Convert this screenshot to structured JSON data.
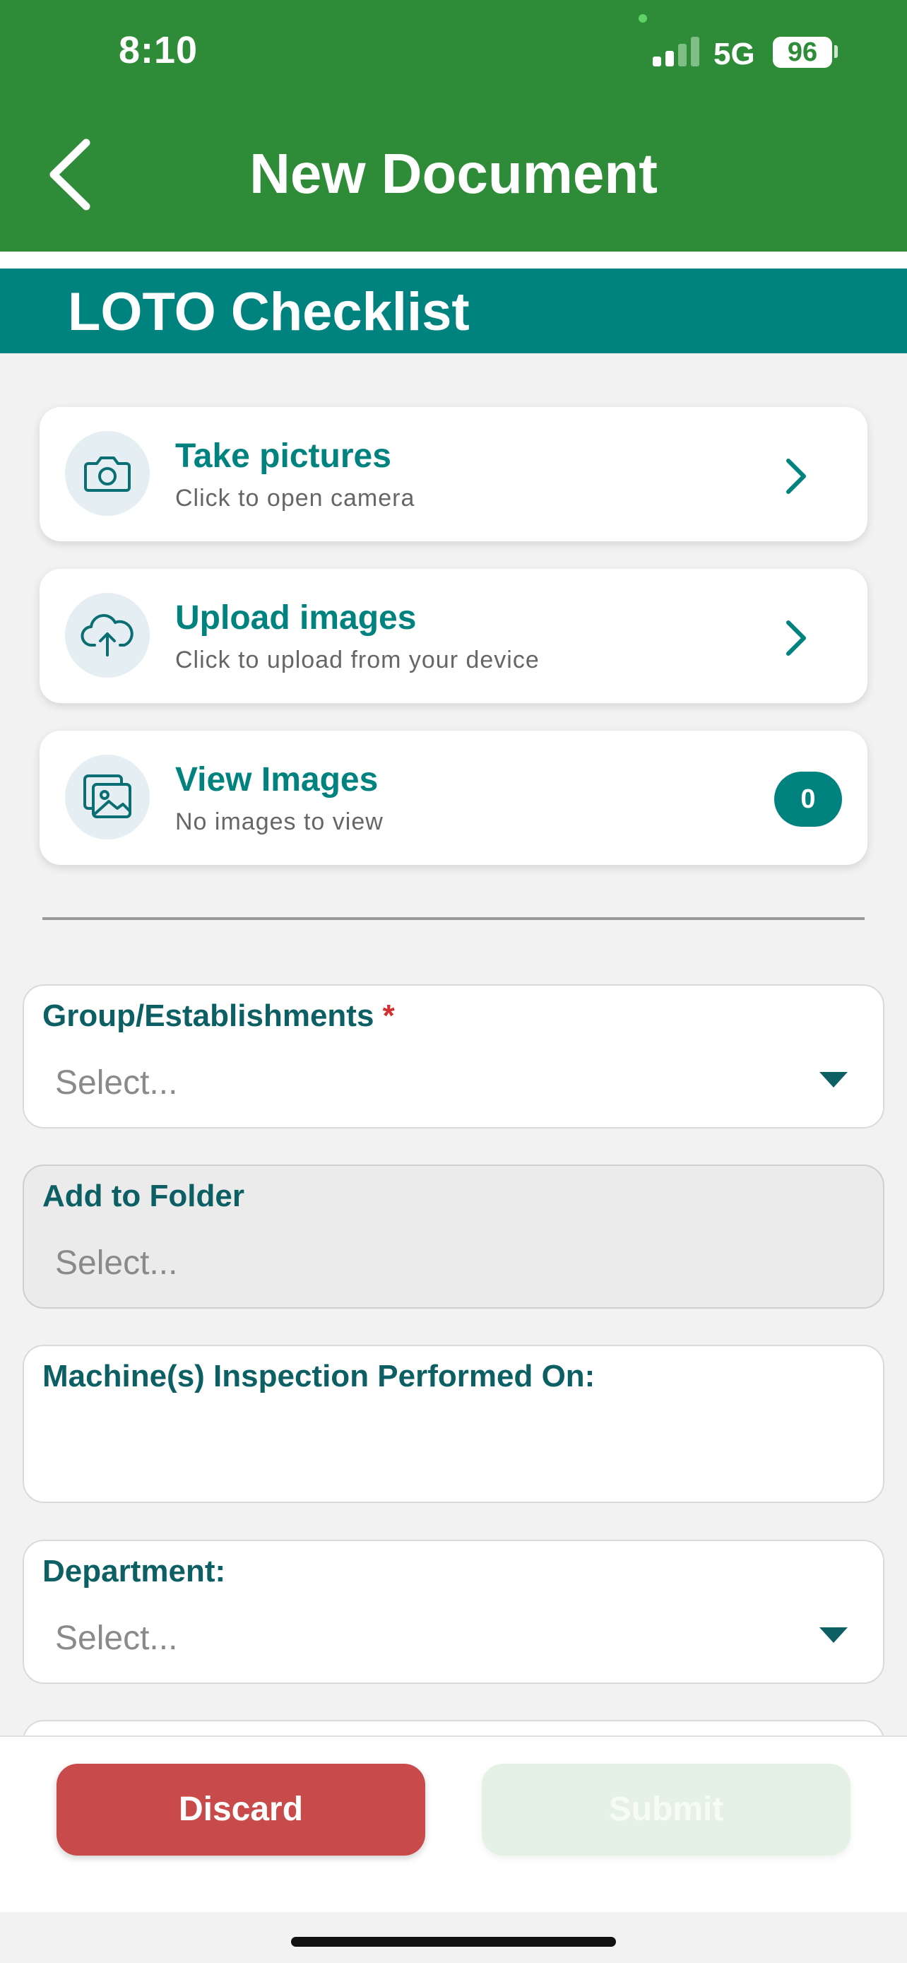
{
  "status_bar": {
    "time": "8:10",
    "network": "5G",
    "battery": "96"
  },
  "header": {
    "title": "New Document"
  },
  "section": {
    "title": "LOTO Checklist"
  },
  "actions": [
    {
      "title": "Take pictures",
      "subtitle": "Click to open camera",
      "icon": "camera-icon"
    },
    {
      "title": "Upload images",
      "subtitle": "Click to upload from your device",
      "icon": "cloud-upload-icon"
    },
    {
      "title": "View Images",
      "subtitle": "No images to view",
      "icon": "image-gallery-icon",
      "count": "0"
    }
  ],
  "fields": {
    "group": {
      "label": "Group/Establishments",
      "required_mark": "*",
      "placeholder": "Select..."
    },
    "folder": {
      "label": "Add to Folder",
      "placeholder": "Select..."
    },
    "machine": {
      "label": "Machine(s) Inspection Performed On:",
      "value": ""
    },
    "department": {
      "label": "Department:",
      "placeholder": "Select..."
    }
  },
  "buttons": {
    "discard": "Discard",
    "submit": "Submit"
  },
  "colors": {
    "header_green": "#2e8b37",
    "teal": "#00827f",
    "discard_red": "#c94a4a"
  }
}
